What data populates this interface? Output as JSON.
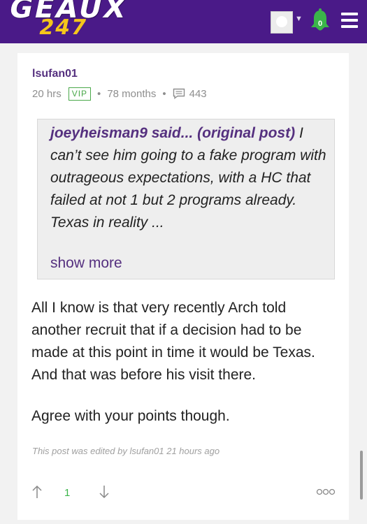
{
  "header": {
    "logo_top": "GEAUX",
    "logo_bottom": "247",
    "notification_count": "0",
    "colors": {
      "bar": "#4a1a88",
      "logo_accent": "#f5c61b",
      "badge": "#3bb54a"
    }
  },
  "post": {
    "author": "lsufan01",
    "time": "20 hrs",
    "badge": "VIP",
    "tenure": "78 months",
    "post_count": "443",
    "quote": {
      "author": "joeyheisman9 said...",
      "link_text": "(original post)",
      "text": " I can’t see him going to a fake program with outrageous expectations, with a HC that failed at not 1 but 2 programs already. Texas in reality ...",
      "show_more": "show more"
    },
    "paragraphs": [
      "All I know is that very recently Arch told another recruit that if a decision had to be made at this point in time it would be Texas. And that was before his visit there.",
      "Agree with your points though."
    ],
    "edited_note": "This post was edited by lsufan01 21 hours ago",
    "vote_count": "1"
  },
  "icons": {
    "avatar": "avatar",
    "caret": "chevron-down-icon",
    "bell": "bell-icon",
    "menu": "hamburger-icon",
    "posts": "message-icon",
    "upvote": "arrow-up-icon",
    "downvote": "arrow-down-icon",
    "more": "more-options-icon"
  }
}
